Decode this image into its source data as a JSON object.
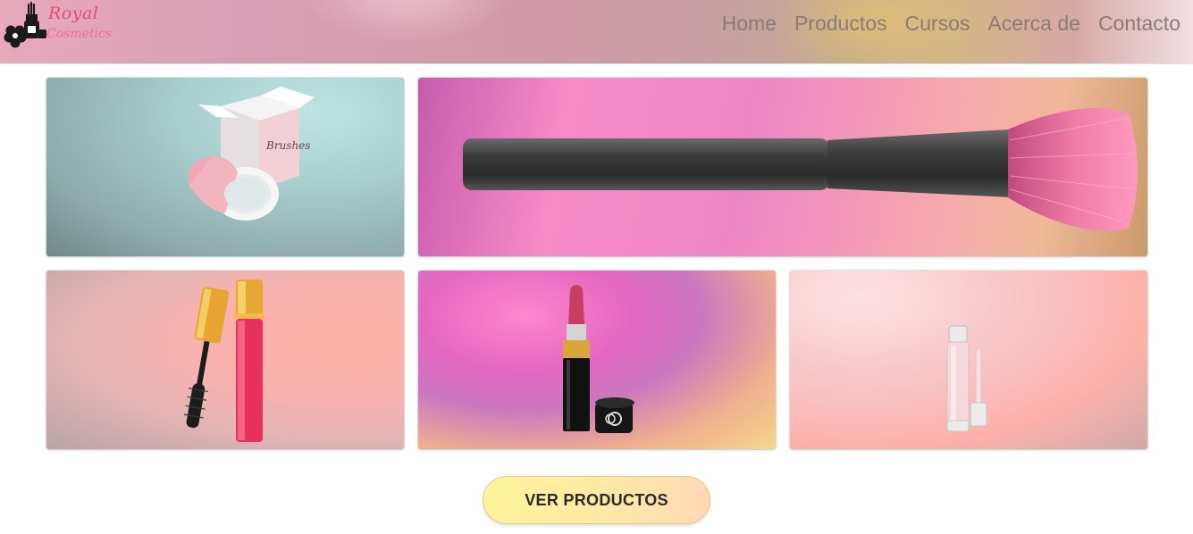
{
  "header": {
    "logo": {
      "line1": "Royal",
      "line2": "Cosmetics",
      "icon": "cosmetics-logo-icon"
    },
    "nav": [
      {
        "label": "Home"
      },
      {
        "label": "Productos"
      },
      {
        "label": "Cursos"
      },
      {
        "label": "Acerca de"
      },
      {
        "label": "Contacto"
      }
    ]
  },
  "gallery": [
    {
      "name": "cosmetic-jar-box-image",
      "box_brand": "Brushes"
    },
    {
      "name": "makeup-brush-image"
    },
    {
      "name": "mascara-image"
    },
    {
      "name": "lipstick-image"
    },
    {
      "name": "lip-gloss-image"
    }
  ],
  "cta": {
    "label": "VER PRODUCTOS"
  },
  "colors": {
    "accent": "#e84c74",
    "nav_text": "#8c7a77",
    "button_start": "#fff59a",
    "button_end": "#ffd9b5"
  }
}
